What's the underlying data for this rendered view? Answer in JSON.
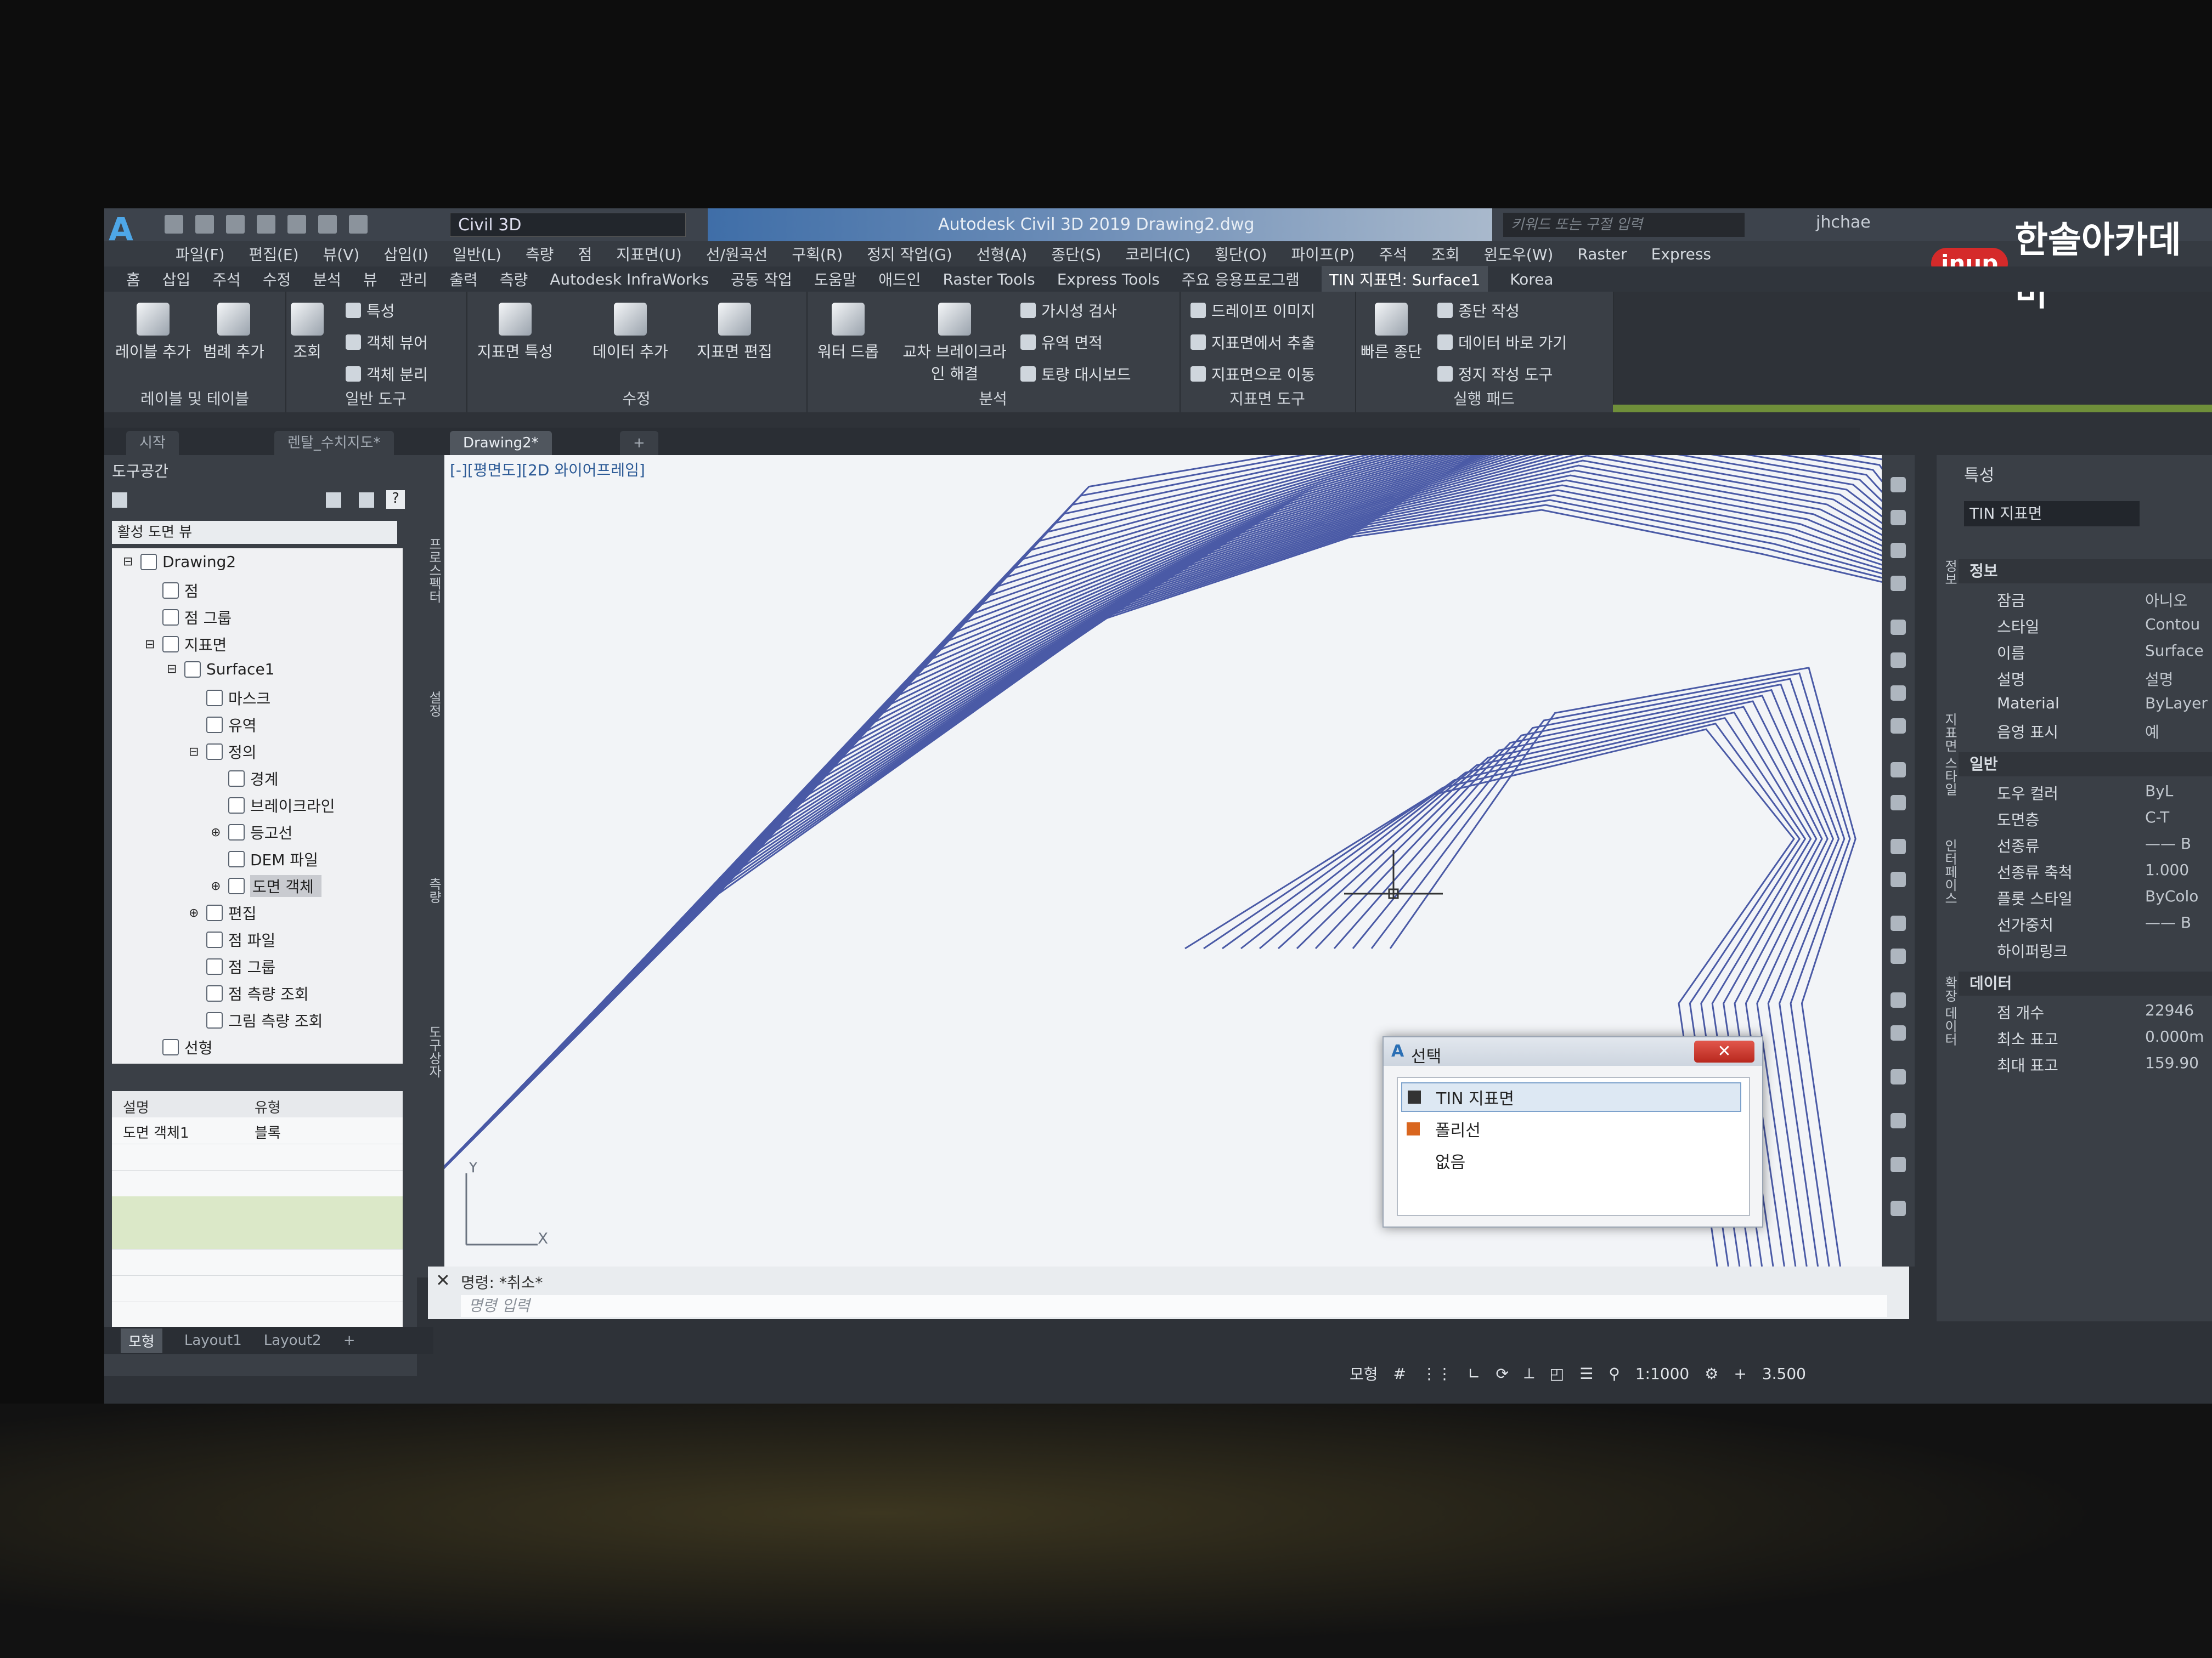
{
  "app": {
    "workspace": "Civil 3D",
    "title": "Autodesk Civil 3D 2019   Drawing2.dwg",
    "search_placeholder": "키워드 또는 구절 입력",
    "user": "jhchae"
  },
  "menubar": [
    "파일(F)",
    "편집(E)",
    "뷰(V)",
    "삽입(I)",
    "일반(L)",
    "측량",
    "점",
    "지표면(U)",
    "선/원곡선",
    "구획(R)",
    "정지 작업(G)",
    "선형(A)",
    "종단(S)",
    "코리더(C)",
    "횡단(O)",
    "파이프(P)",
    "주석",
    "조회",
    "윈도우(W)",
    "Raster",
    "Express"
  ],
  "brand": {
    "logo": "inup",
    "name": "한솔아카데미"
  },
  "ribbon_tabs": [
    "홈",
    "삽입",
    "주석",
    "수정",
    "분석",
    "뷰",
    "관리",
    "출력",
    "측량",
    "Autodesk InfraWorks",
    "공동 작업",
    "도움말",
    "애드인",
    "Raster Tools",
    "Express Tools",
    "주요 응용프로그램",
    "TIN 지표면: Surface1",
    "Korea"
  ],
  "ribbon_groups": {
    "labels_tables": {
      "title": "레이블 및 테이블",
      "add_label": "레이블 추가",
      "add_legend": "범례 추가"
    },
    "general_tools": {
      "title": "일반 도구",
      "query": "조회",
      "properties": "특성",
      "object_viewer": "객체 뷰어",
      "isolate_objects": "객체 분리"
    },
    "modify": {
      "title": "수정",
      "surface_properties": "지표면 특성",
      "add_data": "데이터 추가",
      "edit_surface": "지표면 편집"
    },
    "analyze": {
      "title": "분석",
      "water_drop": "워터 드롭",
      "resolve_crossing": "교차 브레이크라인 해결",
      "visibility_check": "가시성 검사",
      "catchment_area": "유역 면적",
      "volumes_dashboard": "토량 대시보드"
    },
    "surface_tools": {
      "title": "지표면 도구",
      "drape_image": "드레이프 이미지",
      "extract_from_surface": "지표면에서 추출",
      "move_to_surface": "지표면으로 이동"
    },
    "launch_pad": {
      "title": "실행 패드",
      "quick_profile": "빠른 종단",
      "create_profile": "종단 작성",
      "data_shortcuts": "데이터 바로 가기",
      "grading_tools": "정지 작성 도구"
    }
  },
  "doc_tabs": [
    "시작",
    "렌탈_수치지도*",
    "Drawing2*"
  ],
  "toolspace": {
    "header": "도구공간",
    "view_dropdown": "활성 도면 뷰",
    "tree": [
      "Drawing2",
      "점",
      "점 그룹",
      "지표면",
      "Surface1",
      "마스크",
      "유역",
      "정의",
      "경계",
      "브레이크라인",
      "등고선",
      "DEM 파일",
      "도면 객체",
      "편집",
      "점 파일",
      "점 그룹",
      "점 측량 조회",
      "그림 측량 조회",
      "선형"
    ],
    "list_headers": [
      "설명",
      "유형"
    ],
    "list_rows": [
      {
        "desc": "도면 객체1",
        "type": "블록"
      }
    ]
  },
  "side_tabs": {
    "left": [
      "프로스펙터",
      "설정",
      "측량",
      "도구상자"
    ],
    "right": [
      "정보",
      "지표면 스타일",
      "인터페이스",
      "확장 데이터"
    ]
  },
  "viewport": {
    "label": "[-][평면도][2D 와이어프레임]"
  },
  "dialog": {
    "title": "선택",
    "items": [
      {
        "label": "TIN 지표면",
        "color": "#333333"
      },
      {
        "label": "폴리선",
        "color": "#d9661f"
      },
      {
        "label": "없음",
        "color": ""
      }
    ]
  },
  "command": {
    "history": "명령: *취소*",
    "placeholder": "명령 입력"
  },
  "layout_tabs": [
    "모형",
    "Layout1",
    "Layout2"
  ],
  "status": {
    "model": "모형",
    "scale": "1:1000",
    "value": "3.500"
  },
  "properties": {
    "title": "특성",
    "selection": "TIN 지표면",
    "sections": [
      {
        "title": "정보",
        "rows": [
          [
            "잠금",
            "아니오"
          ],
          [
            "스타일",
            "Contou"
          ],
          [
            "이름",
            "Surface"
          ],
          [
            "설명",
            "설명"
          ],
          [
            "Material",
            "ByLayer"
          ],
          [
            "음영 표시",
            "예"
          ]
        ]
      },
      {
        "title": "일반",
        "rows": [
          [
            "도우 컬러",
            "ByL"
          ],
          [
            "도면층",
            "C-T"
          ],
          [
            "선종류",
            "—— B"
          ],
          [
            "선종류 축척",
            "1.000"
          ],
          [
            "플롯 스타일",
            "ByColo"
          ],
          [
            "선가중치",
            "—— B"
          ],
          [
            "하이퍼링크",
            ""
          ]
        ]
      },
      {
        "title": "데이터",
        "rows": [
          [
            "점 개수",
            "22946"
          ],
          [
            "최소 표고",
            "0.000m"
          ],
          [
            "최대 표고",
            "159.90"
          ]
        ]
      }
    ]
  }
}
